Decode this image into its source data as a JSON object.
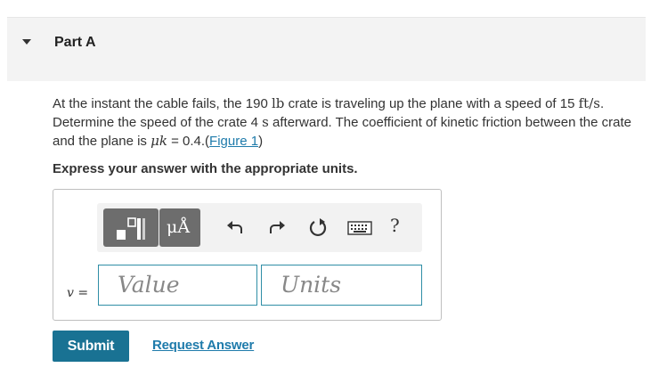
{
  "part": {
    "title": "Part A"
  },
  "problem": {
    "seg1": "At the instant the cable fails, the 190 ",
    "unit_lb": "lb",
    "seg2": " crate is traveling up the plane with a speed of 15 ",
    "unit_ftps": "ft/s",
    "seg3": ". Determine the speed of the crate 4 ",
    "unit_s": "s",
    "seg4": " afterward. The coefficient of kinetic friction between the crate and the plane is ",
    "mu": "μk",
    "seg5": " = 0.4.(",
    "figure_link": "Figure 1",
    "seg6": ")"
  },
  "instruction": "Express your answer with the appropriate units.",
  "toolbar": {
    "units_button": "μÅ",
    "help_label": "?",
    "icons": [
      "templates-icon",
      "units-icon",
      "undo-icon",
      "redo-icon",
      "reset-icon",
      "keyboard-icon",
      "help-icon"
    ]
  },
  "answer": {
    "variable_label": "v =",
    "value_placeholder": "Value",
    "units_placeholder": "Units"
  },
  "actions": {
    "submit_label": "Submit",
    "request_label": "Request Answer"
  },
  "colors": {
    "accent": "#197293",
    "link": "#1f7bab",
    "field_border": "#2f8ea6",
    "header_bg": "#f3f3f3"
  }
}
